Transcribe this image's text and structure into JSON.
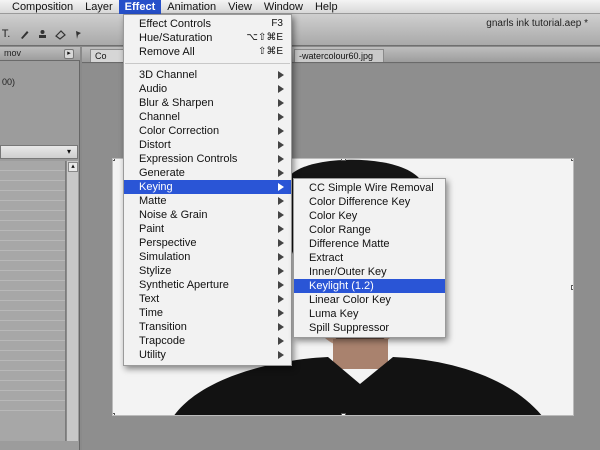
{
  "menubar": {
    "items": [
      "Composition",
      "Layer",
      "Effect",
      "Animation",
      "View",
      "Window",
      "Help"
    ],
    "active": "Effect"
  },
  "toolbar": {
    "doc_title": "gnarls ink tutorial.aep *",
    "tool_icons": [
      "text-tool-icon",
      "pen-tool-icon",
      "clone-stamp-icon",
      "eraser-icon",
      "puppet-pin-icon"
    ]
  },
  "left_panel": {
    "tab_text": "mov",
    "info_text": "00)"
  },
  "composition": {
    "tab1": "Co",
    "tab2": "-watercolour60.jpg"
  },
  "effect_menu": {
    "effect_controls": {
      "label": "Effect Controls",
      "shortcut": "F3"
    },
    "hue_saturation": {
      "label": "Hue/Saturation",
      "shortcut": "⌥⇧⌘E"
    },
    "remove_all": {
      "label": "Remove All",
      "shortcut": "⇧⌘E"
    },
    "categories": [
      "3D Channel",
      "Audio",
      "Blur & Sharpen",
      "Channel",
      "Color Correction",
      "Distort",
      "Expression Controls",
      "Generate",
      "Keying",
      "Matte",
      "Noise & Grain",
      "Paint",
      "Perspective",
      "Simulation",
      "Stylize",
      "Synthetic Aperture",
      "Text",
      "Time",
      "Transition",
      "Trapcode",
      "Utility"
    ],
    "highlighted": "Keying"
  },
  "keying_submenu": {
    "items": [
      "CC Simple Wire Removal",
      "Color Difference Key",
      "Color Key",
      "Color Range",
      "Difference Matte",
      "Extract",
      "Inner/Outer Key",
      "Keylight (1.2)",
      "Linear Color Key",
      "Luma Key",
      "Spill Suppressor"
    ],
    "highlighted": "Keylight (1.2)"
  },
  "colors": {
    "highlight": "#2a55d6",
    "menu_bg": "#f2f2f2",
    "panel_bg": "#8e8e8e"
  }
}
